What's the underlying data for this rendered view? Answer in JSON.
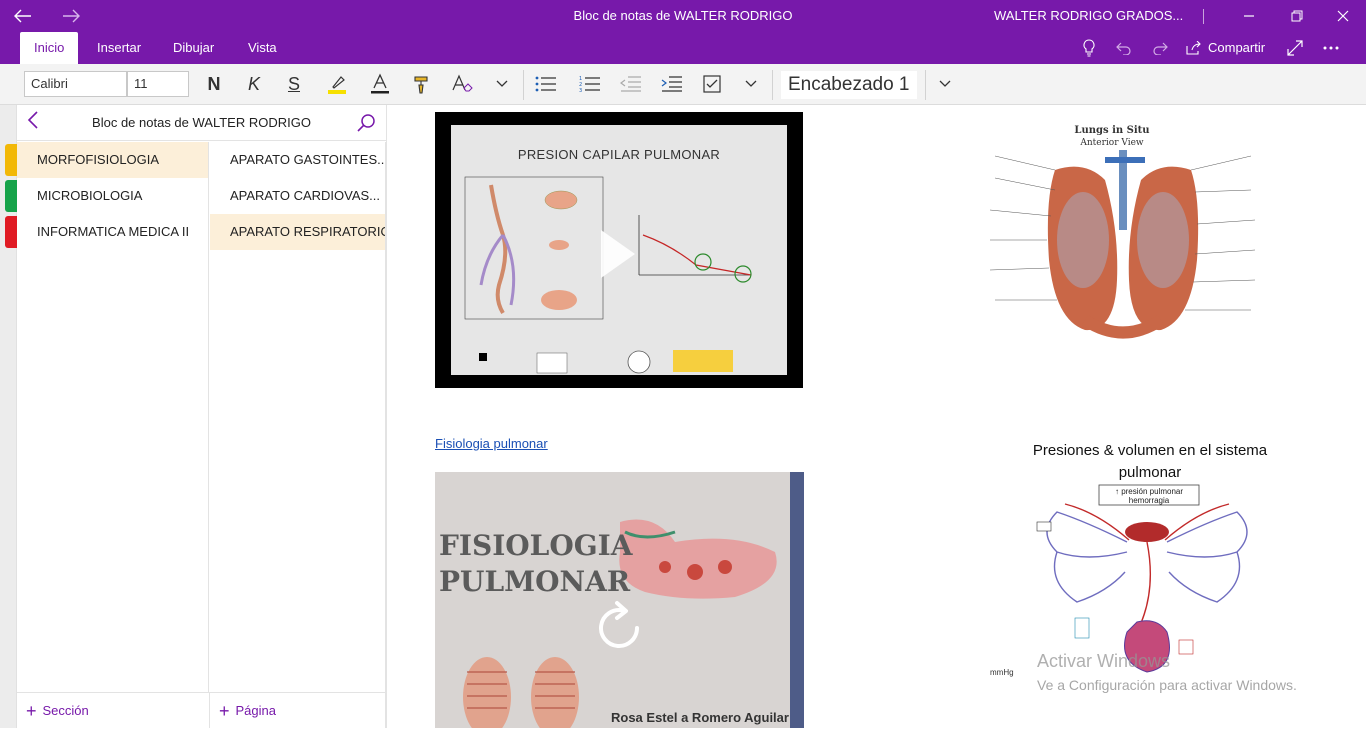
{
  "window": {
    "title": "Bloc de notas de WALTER RODRIGO",
    "user": "WALTER RODRIGO GRADOS...",
    "back_icon": "arrow-left-icon",
    "forward_icon": "arrow-right-icon",
    "accent": "#7719aa"
  },
  "tabs": [
    {
      "label": "Inicio",
      "active": true
    },
    {
      "label": "Insertar"
    },
    {
      "label": "Dibujar"
    },
    {
      "label": "Vista"
    }
  ],
  "share_label": "Compartir",
  "ribbon": {
    "font_name": "Calibri",
    "font_size": "11",
    "bold": "N",
    "italic": "K",
    "strike": "S",
    "style": "Encabezado 1",
    "highlight_color": "#f6e000",
    "font_color": "#222222"
  },
  "notebook": {
    "name": "Bloc de notas de WALTER RODRIGO",
    "sections": [
      {
        "label": "MORFOFISIOLOGIA",
        "color": "#f2b807",
        "selected": true
      },
      {
        "label": "MICROBIOLOGIA",
        "color": "#16a34a"
      },
      {
        "label": "INFORMATICA MEDICA II",
        "color": "#e01b24"
      }
    ],
    "pages": [
      {
        "label": "APARATO GASTOINTES..."
      },
      {
        "label": "APARATO CARDIOVAS..."
      },
      {
        "label": "APARATO RESPIRATORIO",
        "selected": true
      }
    ],
    "add_section": "Sección",
    "add_page": "Página"
  },
  "content": {
    "video1_title": "PRESION CAPILAR PULMONAR",
    "link_text": "Fisiologia pulmonar",
    "video2_title_line1": "FISIOLOGIA",
    "video2_title_line2": "PULMONAR",
    "video2_author": "Rosa Estel a Romero Aguilar",
    "lungs_title": "Lungs in Situ",
    "lungs_subtitle": "Anterior View",
    "pressures_title": "Presiones & volumen en el sistema pulmonar",
    "pressures_unit": "mmHg",
    "pressures_box": "↑ presión pulmonar hemorragia"
  },
  "watermark": {
    "line1": "Activar Windows",
    "line2": "Ve a Configuración para activar Windows."
  }
}
